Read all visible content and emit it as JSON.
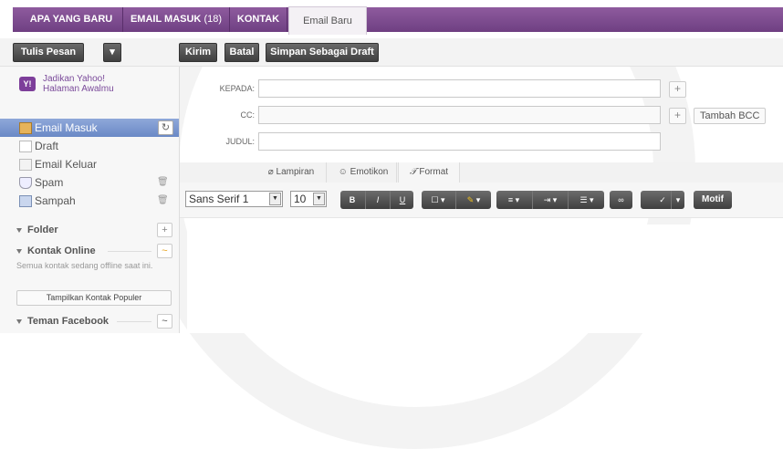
{
  "tabs": [
    {
      "label": "APA YANG BARU"
    },
    {
      "label": "EMAIL MASUK",
      "count": "(18)"
    },
    {
      "label": "KONTAK"
    },
    {
      "label": "Email Baru"
    }
  ],
  "toolbar": {
    "compose_label": "Tulis Pesan",
    "send_label": "Kirim",
    "cancel_label": "Batal",
    "save_draft_label": "Simpan Sebagai Draft"
  },
  "sidebar": {
    "homepage_line1": "Jadikan Yahoo!",
    "homepage_line2": "Halaman Awalmu",
    "items": [
      {
        "label": "Email Masuk"
      },
      {
        "label": "Draft"
      },
      {
        "label": "Email Keluar"
      },
      {
        "label": "Spam"
      },
      {
        "label": "Sampah"
      }
    ],
    "folder_label": "Folder",
    "online_contacts_label": "Kontak Online",
    "offline_note": "Semua kontak sedang offline saat ini.",
    "popular_contacts_button": "Tampilkan Kontak Populer",
    "facebook_friends_label": "Teman Facebook"
  },
  "compose": {
    "to_label": "KEPADA:",
    "cc_label": "CC:",
    "subject_label": "JUDUL:",
    "add_bcc_label": "Tambah BCC",
    "to_value": "",
    "cc_value": "",
    "subject_value": ""
  },
  "editor_tabs": {
    "attachment_label": "Lampiran",
    "emoticon_label": "Emotikon",
    "format_label": "Format"
  },
  "format": {
    "font_family": "Sans Serif 1",
    "font_size": "10",
    "bold": "B",
    "italic": "I",
    "underline": "U",
    "theme_label": "Motif"
  },
  "colors": {
    "tab_purple": "#7a4a8c",
    "selected_blue": "#7896cf",
    "dark_button": "#4a4a4a"
  }
}
